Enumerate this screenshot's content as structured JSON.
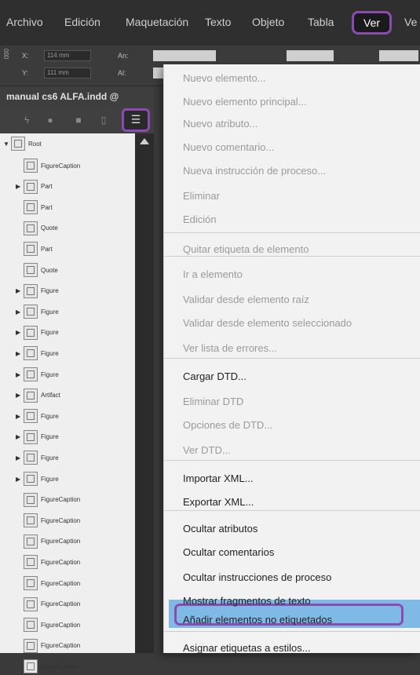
{
  "menubar": {
    "items": [
      "Archivo",
      "Edición",
      "Maquetación",
      "Texto",
      "Objeto",
      "Tabla",
      "Ver",
      "Ve"
    ],
    "active": "Ver"
  },
  "control": {
    "x_label": "X:",
    "x_value": "114 mm",
    "y_label": "Y:",
    "y_value": "111 mm",
    "an_label": "An:",
    "al_label": "Al:",
    "side_tag": "000"
  },
  "panel": {
    "doc_title": "manual cs6 ALFA.indd @",
    "root_label": "Root",
    "tree_items": [
      {
        "label": "FigureCaption",
        "arrow": false
      },
      {
        "label": "Part",
        "arrow": true
      },
      {
        "label": "Part",
        "arrow": false
      },
      {
        "label": "Quote",
        "arrow": false
      },
      {
        "label": "Part",
        "arrow": false
      },
      {
        "label": "Quote",
        "arrow": false
      },
      {
        "label": "Figure",
        "arrow": true
      },
      {
        "label": "Figure",
        "arrow": true
      },
      {
        "label": "Figure",
        "arrow": true
      },
      {
        "label": "Figure",
        "arrow": true
      },
      {
        "label": "Figure",
        "arrow": true
      },
      {
        "label": "Artifact",
        "arrow": true
      },
      {
        "label": "Figure",
        "arrow": true
      },
      {
        "label": "Figure",
        "arrow": true
      },
      {
        "label": "Figure",
        "arrow": true
      },
      {
        "label": "Figure",
        "arrow": true
      },
      {
        "label": "FigureCaption",
        "arrow": false
      },
      {
        "label": "FigureCaption",
        "arrow": false
      },
      {
        "label": "FigureCaption",
        "arrow": false
      },
      {
        "label": "FigureCaption",
        "arrow": false
      },
      {
        "label": "FigureCaption",
        "arrow": false
      },
      {
        "label": "FigureCaption",
        "arrow": false
      },
      {
        "label": "FigureCaption",
        "arrow": false
      },
      {
        "label": "FigureCaption",
        "arrow": false
      },
      {
        "label": "FigureCaption",
        "arrow": false
      }
    ]
  },
  "dropdown": {
    "items": [
      {
        "label": "Nuevo elemento...",
        "enabled": false
      },
      {
        "label": "Nuevo elemento principal...",
        "enabled": false
      },
      {
        "label": "Nuevo atributo...",
        "enabled": false
      },
      {
        "label": "Nuevo comentario...",
        "enabled": false
      },
      {
        "label": "Nueva instrucción de proceso...",
        "enabled": false
      },
      {
        "label": "Eliminar",
        "enabled": false
      },
      {
        "label": "Edición",
        "enabled": false
      },
      {
        "label": "Quitar etiqueta de elemento",
        "enabled": false
      },
      {
        "label": "Ir a elemento",
        "enabled": false
      },
      {
        "label": "Validar desde elemento raíz",
        "enabled": false
      },
      {
        "label": "Validar desde elemento seleccionado",
        "enabled": false
      },
      {
        "label": "Ver lista de errores...",
        "enabled": false
      },
      {
        "label": "Cargar DTD...",
        "enabled": true
      },
      {
        "label": "Eliminar DTD",
        "enabled": false
      },
      {
        "label": "Opciones de DTD...",
        "enabled": false
      },
      {
        "label": "Ver DTD...",
        "enabled": false
      },
      {
        "label": "Importar XML...",
        "enabled": true
      },
      {
        "label": "Exportar XML...",
        "enabled": true
      },
      {
        "label": "Ocultar atributos",
        "enabled": true
      },
      {
        "label": "Ocultar comentarios",
        "enabled": true
      },
      {
        "label": "Ocultar instrucciones de proceso",
        "enabled": true
      },
      {
        "label": "Mostrar fragmentos de texto",
        "enabled": true
      },
      {
        "label": "Añadir elementos no etiquetados",
        "enabled": true
      },
      {
        "label": "Asignar etiquetas a estilos...",
        "enabled": true
      }
    ],
    "highlighted": "Añadir elementos no etiquetados"
  },
  "colors": {
    "highlight": "#7fb9e6",
    "outline": "#8b4bb0",
    "menubar": "#2f2f2f"
  }
}
